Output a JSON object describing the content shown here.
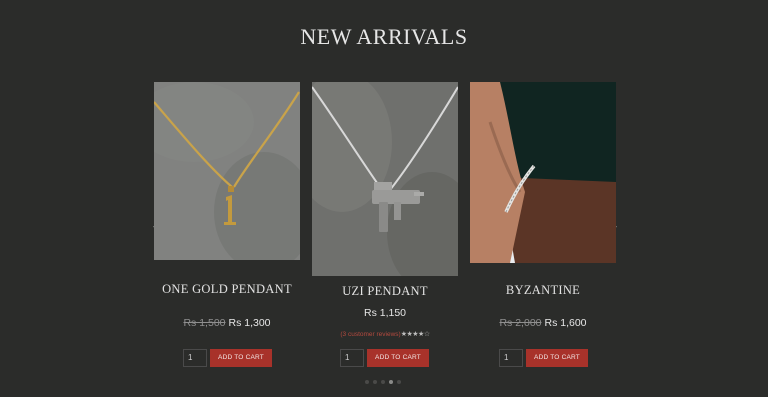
{
  "section": {
    "title": "NEW ARRIVALS"
  },
  "carousel": {
    "prev_icon": "chevron-left-icon",
    "next_icon": "chevron-right-icon",
    "prev": "‹",
    "next": "›",
    "active_page": 4,
    "page_count": 5
  },
  "products": [
    {
      "name": "ONE GOLD PENDANT",
      "old_price": "Rs 1,500",
      "price": "Rs 1,300",
      "qty": "1",
      "cart_label": "ADD TO CART"
    },
    {
      "name": "UZI PENDANT",
      "price": "Rs 1,150",
      "reviews_label": "(3 customer reviews)",
      "stars": "★★★★☆",
      "rating": 4,
      "qty": "1",
      "cart_label": "ADD TO CART"
    },
    {
      "name": "BYZANTINE",
      "old_price": "Rs 2,000",
      "price": "Rs 1,600",
      "qty": "1",
      "cart_label": "ADD TO CART"
    }
  ],
  "colors": {
    "background": "#2b2c2a",
    "accent": "#a8322a",
    "review_link": "#b54a3f"
  }
}
